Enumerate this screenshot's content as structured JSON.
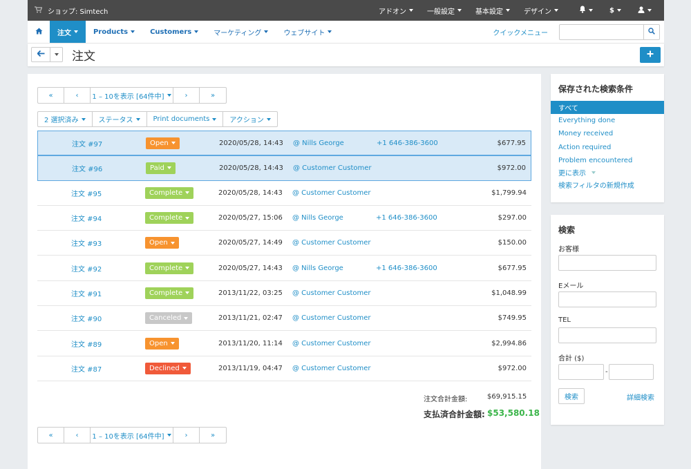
{
  "topbar": {
    "shop_label": "ショップ: Simtech",
    "menu": [
      "アドオン",
      "一般設定",
      "基本設定",
      "デザイン"
    ],
    "currency": "$"
  },
  "nav": {
    "items": [
      "注文",
      "Products",
      "Customers",
      "マーケティング",
      "ウェブサイト"
    ],
    "quick_menu": "クイックメニュー"
  },
  "page": {
    "title": "注文"
  },
  "pager": {
    "first": "«",
    "prev": "‹",
    "info": "1 – 10を表示 [64件中]",
    "next": "›",
    "last": "»"
  },
  "actions": [
    "2 選択済み",
    "ステータス",
    "Print documents",
    "アクション"
  ],
  "orders": [
    {
      "id": "注文 #97",
      "status": "Open",
      "status_color": "#f7932f",
      "date": "2020/05/28, 14:43",
      "customer": "@ Nills George",
      "phone": "+1 646-386-3600",
      "amount": "$677.95",
      "selected": true
    },
    {
      "id": "注文 #96",
      "status": "Paid",
      "status_color": "#9fd25a",
      "date": "2020/05/28, 14:43",
      "customer": "@ Customer Customer",
      "phone": "",
      "amount": "$972.00",
      "selected": true
    },
    {
      "id": "注文 #95",
      "status": "Complete",
      "status_color": "#9fd25a",
      "date": "2020/05/28, 14:43",
      "customer": "@ Customer Customer",
      "phone": "",
      "amount": "$1,799.94",
      "selected": false
    },
    {
      "id": "注文 #94",
      "status": "Complete",
      "status_color": "#9fd25a",
      "date": "2020/05/27, 15:06",
      "customer": "@ Nills George",
      "phone": "+1 646-386-3600",
      "amount": "$297.00",
      "selected": false
    },
    {
      "id": "注文 #93",
      "status": "Open",
      "status_color": "#f7932f",
      "date": "2020/05/27, 14:49",
      "customer": "@ Customer Customer",
      "phone": "",
      "amount": "$150.00",
      "selected": false
    },
    {
      "id": "注文 #92",
      "status": "Complete",
      "status_color": "#9fd25a",
      "date": "2020/05/27, 14:43",
      "customer": "@ Nills George",
      "phone": "+1 646-386-3600",
      "amount": "$677.95",
      "selected": false
    },
    {
      "id": "注文 #91",
      "status": "Complete",
      "status_color": "#9fd25a",
      "date": "2013/11/22, 03:25",
      "customer": "@ Customer Customer",
      "phone": "",
      "amount": "$1,048.99",
      "selected": false
    },
    {
      "id": "注文 #90",
      "status": "Canceled",
      "status_color": "#c8c8c8",
      "date": "2013/11/21, 02:47",
      "customer": "@ Customer Customer",
      "phone": "",
      "amount": "$749.95",
      "selected": false
    },
    {
      "id": "注文 #89",
      "status": "Open",
      "status_color": "#f7932f",
      "date": "2013/11/20, 11:14",
      "customer": "@ Customer Customer",
      "phone": "",
      "amount": "$2,994.86",
      "selected": false
    },
    {
      "id": "注文 #87",
      "status": "Declined",
      "status_color": "#f05a3a",
      "date": "2013/11/19, 04:47",
      "customer": "@ Customer Customer",
      "phone": "",
      "amount": "$972.00",
      "selected": false
    }
  ],
  "totals": {
    "order_total_label": "注文合計金額:",
    "order_total_value": "$69,915.15",
    "paid_total_label": "支払済合計金額:",
    "paid_total_value": "$53,580.18"
  },
  "saved_searches": {
    "title": "保存された検索条件",
    "items": [
      "すべて",
      "Everything done",
      "Money received",
      "Action required",
      "Problem encountered",
      "更に表示",
      "検索フィルタの新規作成"
    ]
  },
  "search": {
    "title": "検索",
    "customer_label": "お客様",
    "email_label": "Eメール",
    "phone_label": "TEL",
    "total_label": "合計 ($)",
    "range_sep": "-",
    "search_button": "検索",
    "advanced_link": "詳細検索"
  },
  "colors": {
    "accent": "#1f8ec7",
    "paid_total": "#3bb54a"
  }
}
